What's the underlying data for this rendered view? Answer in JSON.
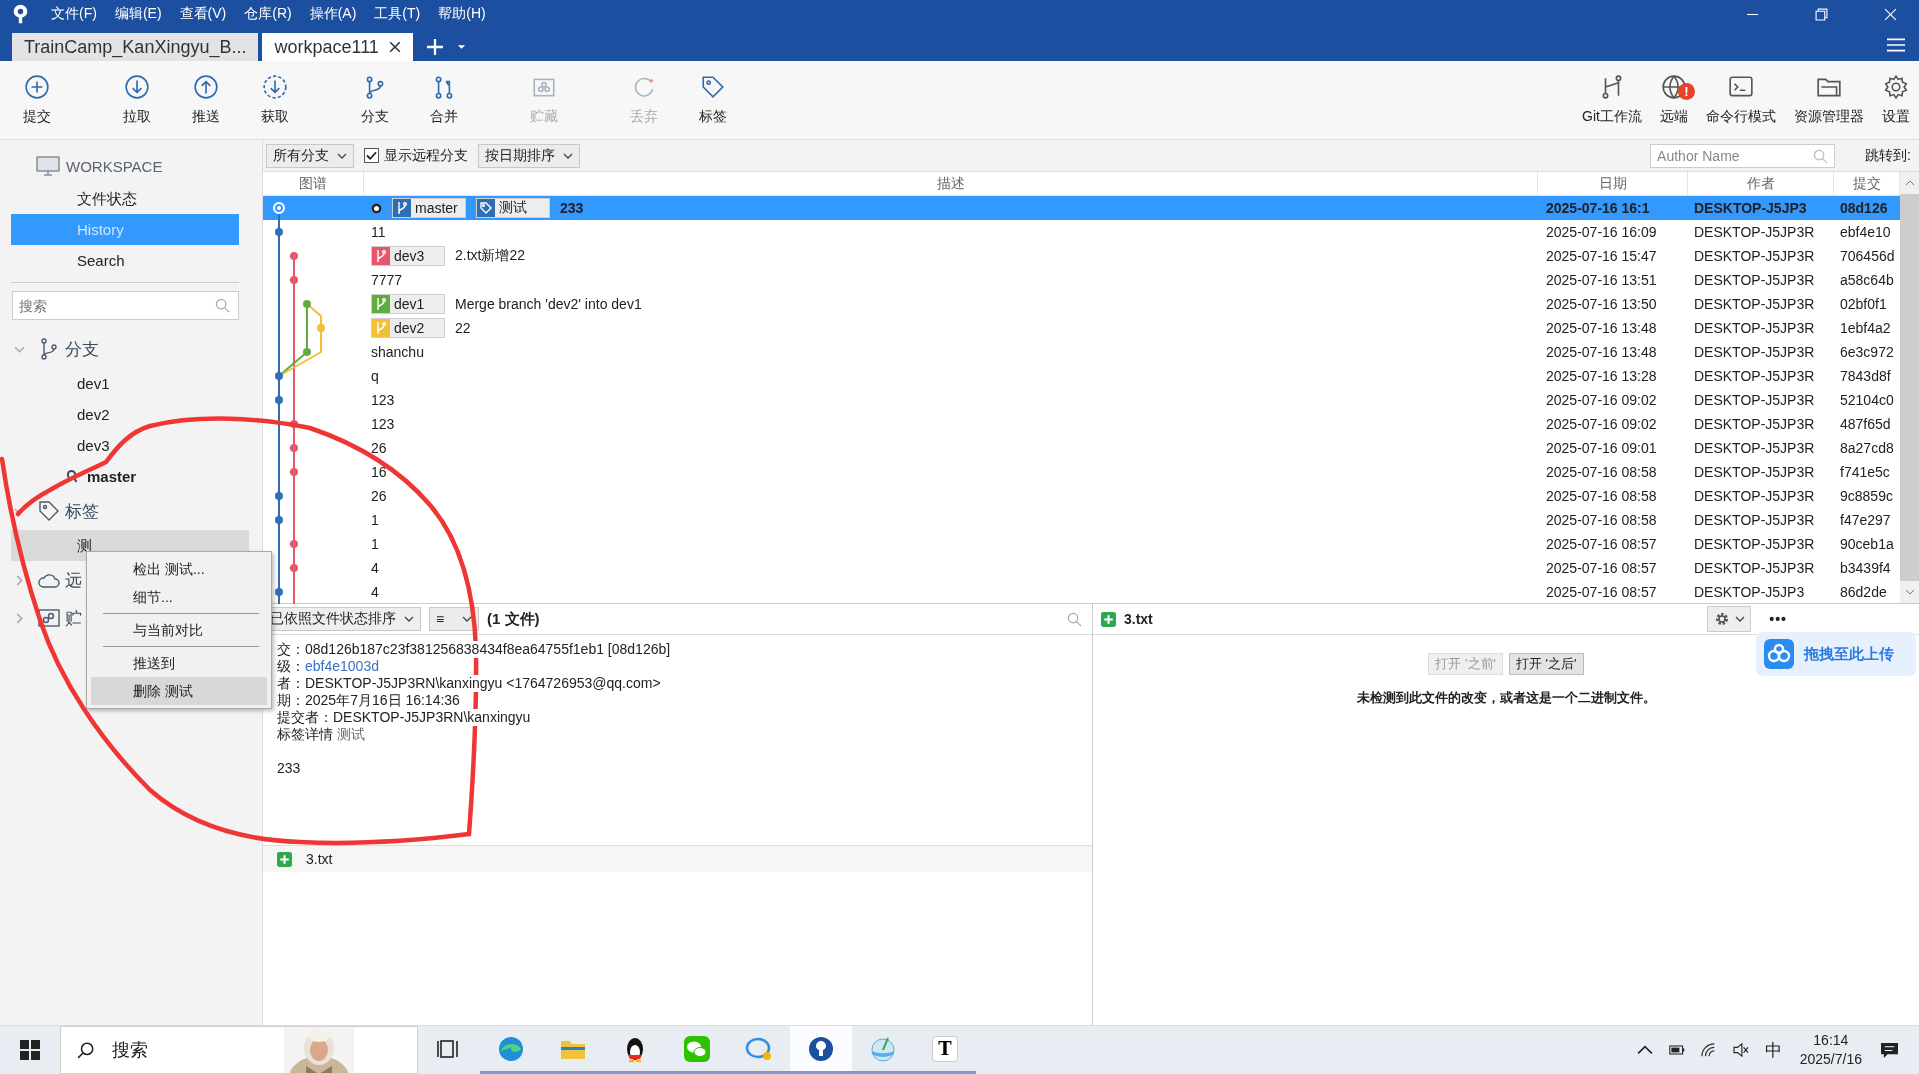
{
  "menu": [
    "文件(F)",
    "编辑(E)",
    "查看(V)",
    "仓库(R)",
    "操作(A)",
    "工具(T)",
    "帮助(H)"
  ],
  "tabs": [
    {
      "label": "TrainCamp_KanXingyu_B...",
      "selected": false
    },
    {
      "label": "workpace111",
      "selected": true
    }
  ],
  "toolbar": {
    "left_groups": [
      [
        {
          "kind": "commit",
          "label": "提交",
          "disabled": false
        }
      ],
      [
        {
          "kind": "pull",
          "label": "拉取",
          "disabled": false
        },
        {
          "kind": "push",
          "label": "推送",
          "disabled": false
        },
        {
          "kind": "fetch",
          "label": "获取",
          "disabled": false
        }
      ],
      [
        {
          "kind": "branch",
          "label": "分支",
          "disabled": false
        },
        {
          "kind": "merge",
          "label": "合并",
          "disabled": false
        }
      ],
      [
        {
          "kind": "stash",
          "label": "贮藏",
          "disabled": true
        }
      ],
      [
        {
          "kind": "discard",
          "label": "丢弃",
          "disabled": true
        },
        {
          "kind": "tag",
          "label": "标签",
          "disabled": false
        }
      ]
    ],
    "right": [
      {
        "kind": "gitflow",
        "label": "Git工作流",
        "disabled": false
      },
      {
        "kind": "remote",
        "label": "远端",
        "disabled": false,
        "alert": "!"
      },
      {
        "kind": "terminal",
        "label": "命令行模式",
        "disabled": false
      },
      {
        "kind": "explorer",
        "label": "资源管理器",
        "disabled": false
      },
      {
        "kind": "settings",
        "label": "设置",
        "disabled": false
      }
    ]
  },
  "sidebar": {
    "workspace": {
      "title": "WORKSPACE",
      "items": [
        {
          "label": "文件状态",
          "selected": false
        },
        {
          "label": "History",
          "selected": true
        },
        {
          "label": "Search",
          "selected": false
        }
      ]
    },
    "search": {
      "placeholder": "搜索"
    },
    "groups": [
      {
        "kind": "branches",
        "label": "分支",
        "expanded": true,
        "children": [
          {
            "label": "dev1",
            "current": false,
            "selected": false
          },
          {
            "label": "dev2",
            "current": false,
            "selected": false
          },
          {
            "label": "dev3",
            "current": false,
            "selected": false
          },
          {
            "label": "master",
            "current": true,
            "selected": false
          }
        ]
      },
      {
        "kind": "tags",
        "label": "标签",
        "expanded": true,
        "children": [
          {
            "label": "测",
            "current": false,
            "selected": true
          }
        ]
      },
      {
        "kind": "remotes",
        "label": "远",
        "expanded": false
      },
      {
        "kind": "stashes",
        "label": "贮",
        "expanded": false
      }
    ]
  },
  "filter_bar": {
    "branch_select": "所有分支",
    "show_remote": {
      "label": "显示远程分支",
      "checked": true
    },
    "sort_select": "按日期排序",
    "author_search": {
      "placeholder": "Author Name"
    },
    "jump_label": "跳转到:"
  },
  "columns": [
    "图谱",
    "描述",
    "日期",
    "作者",
    "提交"
  ],
  "commits": [
    {
      "selected": true,
      "head": true,
      "refs": [
        {
          "kind": "branch",
          "name": "master",
          "color": "#2f6db5"
        },
        {
          "kind": "tag",
          "name": "测试",
          "color": "#2f6db5"
        }
      ],
      "description": "233",
      "date": "2025-07-16 16:1",
      "author": "DESKTOP-J5JP3",
      "hash": "08d126"
    },
    {
      "selected": false,
      "head": false,
      "description": "11",
      "date": "2025-07-16 16:09",
      "author": "DESKTOP-J5JP3R",
      "hash": "ebf4e10"
    },
    {
      "selected": false,
      "head": false,
      "refs": [
        {
          "kind": "branch",
          "name": "dev3",
          "color": "#e8566c"
        }
      ],
      "description": "2.txt新增22",
      "date": "2025-07-16 15:47",
      "author": "DESKTOP-J5JP3R",
      "hash": "706456d"
    },
    {
      "selected": false,
      "head": false,
      "description": "7777",
      "date": "2025-07-16 13:51",
      "author": "DESKTOP-J5JP3R",
      "hash": "a58c64b"
    },
    {
      "selected": false,
      "head": false,
      "refs": [
        {
          "kind": "branch",
          "name": "dev1",
          "color": "#5fad41"
        }
      ],
      "description": "Merge branch 'dev2' into dev1",
      "date": "2025-07-16 13:50",
      "author": "DESKTOP-J5JP3R",
      "hash": "02bf0f1"
    },
    {
      "selected": false,
      "head": false,
      "refs": [
        {
          "kind": "branch",
          "name": "dev2",
          "color": "#f2c037"
        }
      ],
      "description": "22",
      "date": "2025-07-16 13:48",
      "author": "DESKTOP-J5JP3R",
      "hash": "1ebf4a2"
    },
    {
      "selected": false,
      "head": false,
      "description": "shanchu",
      "date": "2025-07-16 13:48",
      "author": "DESKTOP-J5JP3R",
      "hash": "6e3c972"
    },
    {
      "selected": false,
      "head": false,
      "description": "q",
      "date": "2025-07-16 13:28",
      "author": "DESKTOP-J5JP3R",
      "hash": "7843d8f"
    },
    {
      "selected": false,
      "head": false,
      "description": "123",
      "date": "2025-07-16 09:02",
      "author": "DESKTOP-J5JP3R",
      "hash": "52104c0"
    },
    {
      "selected": false,
      "head": false,
      "description": "123",
      "date": "2025-07-16 09:02",
      "author": "DESKTOP-J5JP3R",
      "hash": "487f65d"
    },
    {
      "selected": false,
      "head": false,
      "description": "26",
      "date": "2025-07-16 09:01",
      "author": "DESKTOP-J5JP3R",
      "hash": "8a27cd8"
    },
    {
      "selected": false,
      "head": false,
      "description": "16",
      "date": "2025-07-16 08:58",
      "author": "DESKTOP-J5JP3R",
      "hash": "f741e5c"
    },
    {
      "selected": false,
      "head": false,
      "description": "26",
      "date": "2025-07-16 08:58",
      "author": "DESKTOP-J5JP3R",
      "hash": "9c8859c"
    },
    {
      "selected": false,
      "head": false,
      "description": "1",
      "date": "2025-07-16 08:58",
      "author": "DESKTOP-J5JP3R",
      "hash": "f47e297"
    },
    {
      "selected": false,
      "head": false,
      "description": "1",
      "date": "2025-07-16 08:57",
      "author": "DESKTOP-J5JP3R",
      "hash": "90ceb1a"
    },
    {
      "selected": false,
      "head": false,
      "description": "4",
      "date": "2025-07-16 08:57",
      "author": "DESKTOP-J5JP3R",
      "hash": "b3439f4"
    },
    {
      "selected": false,
      "head": false,
      "description": "4",
      "date": "2025-07-16 08:57",
      "author": "DESKTOP-J5JP3",
      "hash": "86d2de"
    }
  ],
  "details_panel": {
    "sort_select": "已依照文件状态排序",
    "view_button": "≡",
    "file_count": "(1 文件)",
    "lines": [
      {
        "kind": "text",
        "label": "交：",
        "value": "08d126b187c23f381256838434f8ea64755f1eb1 [08d126b]"
      },
      {
        "kind": "link",
        "label": "级：",
        "value": "ebf4e1003d"
      },
      {
        "kind": "text",
        "label": "者：",
        "value": "DESKTOP-J5JP3RN\\kanxingyu <1764726953@qq.com>"
      },
      {
        "kind": "text",
        "label": "期：",
        "value": "2025年7月16日 16:14:36"
      },
      {
        "kind": "text",
        "label": "提交者：",
        "value": "DESKTOP-J5JP3RN\\kanxingyu"
      },
      {
        "kind": "muted",
        "label": "标签详情",
        "value": "测试"
      }
    ],
    "message": "233",
    "files": [
      {
        "name": "3.txt"
      }
    ]
  },
  "diff_panel": {
    "file": {
      "name": "3.txt"
    },
    "buttons": [
      {
        "label": "打开 '之前'",
        "disabled": true
      },
      {
        "label": "打开 '之后'",
        "disabled": false
      }
    ],
    "message": "未检测到此文件的改变，或者这是一个二进制文件。",
    "more": "•••"
  },
  "context_menu": [
    {
      "kind": "item",
      "label": "检出 测试...",
      "highlighted": false
    },
    {
      "kind": "item",
      "label": "细节...",
      "highlighted": false
    },
    {
      "kind": "separator"
    },
    {
      "kind": "item",
      "label": "与当前对比",
      "highlighted": false
    },
    {
      "kind": "separator"
    },
    {
      "kind": "item",
      "label": "推送到",
      "highlighted": false
    },
    {
      "kind": "item",
      "label": "删除 测试",
      "highlighted": true
    }
  ],
  "upload_widget": {
    "label": "拖拽至此上传"
  },
  "taskbar": {
    "search": {
      "placeholder": "搜索"
    },
    "apps": [
      {
        "kind": "taskview",
        "running": false,
        "active": false
      },
      {
        "kind": "browser",
        "running": true,
        "active": false
      },
      {
        "kind": "folder",
        "running": true,
        "active": false
      },
      {
        "kind": "penguin",
        "running": true,
        "active": false
      },
      {
        "kind": "chat",
        "running": true,
        "active": false
      },
      {
        "kind": "bubble",
        "running": true,
        "active": false
      },
      {
        "kind": "pin",
        "running": true,
        "active": true
      },
      {
        "kind": "globe",
        "running": true,
        "active": false
      },
      {
        "kind": "letter",
        "label": "T",
        "running": true,
        "active": false
      }
    ],
    "tray": {
      "ime": "中",
      "time": "16:14",
      "date": "2025/7/16"
    }
  }
}
